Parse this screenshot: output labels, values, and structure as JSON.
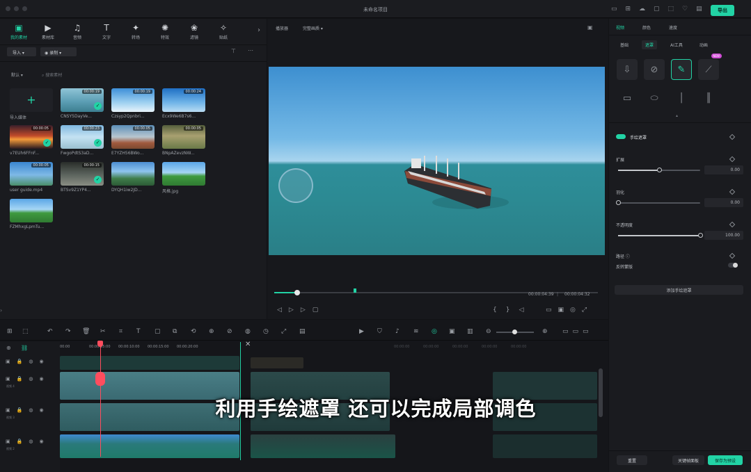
{
  "window": {
    "title": "未命名项目",
    "export_label": "导出"
  },
  "media_tabs": [
    {
      "label": "我的素材",
      "icon": "folder-icon",
      "glyph": "▣",
      "active": true
    },
    {
      "label": "素材库",
      "icon": "library-icon",
      "glyph": "▶",
      "active": false
    },
    {
      "label": "音频",
      "icon": "music-icon",
      "glyph": "♫",
      "active": false
    },
    {
      "label": "文字",
      "icon": "text-icon",
      "glyph": "T",
      "active": false
    },
    {
      "label": "转场",
      "icon": "transition-icon",
      "glyph": "✦",
      "active": false
    },
    {
      "label": "特效",
      "icon": "effects-icon",
      "glyph": "✺",
      "active": false
    },
    {
      "label": "滤镜",
      "icon": "filter-icon",
      "glyph": "❀",
      "active": false
    },
    {
      "label": "贴纸",
      "icon": "sticker-icon",
      "glyph": "✧",
      "active": false
    }
  ],
  "media_toolbar": {
    "import_label": "导入",
    "record_label": "录制"
  },
  "media_filter": {
    "sort_label": "默认",
    "search_placeholder": "搜索素材"
  },
  "import_tile_label": "导入媒体",
  "media_items": [
    {
      "name": "CNSY5DayVe...",
      "duration": "00:00:19",
      "checked": true,
      "style": "a"
    },
    {
      "name": "Czsyp2Qpnbri...",
      "duration": "00:00:19",
      "checked": false,
      "style": "b"
    },
    {
      "name": "Ecx9We6B7s6...",
      "duration": "00:00:24",
      "checked": false,
      "style": "c"
    },
    {
      "name": "v7EUh6FFnF...",
      "duration": "00:00:05",
      "checked": true,
      "style": "d"
    },
    {
      "name": "FwgoPdtS3aD...",
      "duration": "00:00:23",
      "checked": true,
      "style": "e"
    },
    {
      "name": "E7YZH56BWo...",
      "duration": "00:00:05",
      "checked": false,
      "style": "f"
    },
    {
      "name": "BNpAZevzNW...",
      "duration": "00:00:05",
      "checked": false,
      "style": "g"
    },
    {
      "name": "user guide.mp4",
      "duration": "00:00:05",
      "checked": false,
      "style": "h"
    },
    {
      "name": "BTSv9Z1YP4...",
      "duration": "00:00:15",
      "checked": true,
      "style": "i"
    },
    {
      "name": "DYQH1iw2JD...",
      "duration": "",
      "checked": false,
      "style": "j"
    },
    {
      "name": "风格.jpg",
      "duration": "",
      "checked": false,
      "style": "k"
    },
    {
      "name": "FZMhxgLpmTu...",
      "duration": "",
      "checked": false,
      "style": "k"
    }
  ],
  "preview": {
    "player_label": "播放器",
    "quality_label": "完整画质",
    "current_time": "00:00:04:39",
    "total_time": "00:00:04:32",
    "progress": 0.07
  },
  "right_panel": {
    "top_tabs": [
      "视频",
      "颜色",
      "速度"
    ],
    "sub_tabs": [
      "基础",
      "遮罩",
      "AI工具",
      "动画"
    ],
    "new_badge": "NEW",
    "mask_title": "手绘遮罩",
    "params": [
      {
        "label": "扩展",
        "value": "0.00",
        "level": 0.5
      },
      {
        "label": "羽化",
        "value": "0.00",
        "level": 0.0
      },
      {
        "label": "不透明度",
        "value": "100.00",
        "level": 1.0
      }
    ],
    "path_label": "路径",
    "invert_label": "反转蒙版",
    "add_mask_button": "添加手绘遮罩",
    "reset_button": "重置",
    "keyframe_button": "关键帧面板",
    "save_button": "保存为预设"
  },
  "timeline": {
    "ruler_labels": [
      "00:00",
      "00:00:05:00",
      "00:00:10:00",
      "00:00:15:00",
      "00:00:20:00"
    ],
    "track_labels": [
      "",
      "视频 4",
      "视频 3",
      "视频 2"
    ],
    "playhead_fraction": 0.2
  },
  "caption_text": "利用手绘遮罩 还可以完成局部调色",
  "colors": {
    "accent": "#22d3a5",
    "playhead": "#ff4d5e"
  }
}
